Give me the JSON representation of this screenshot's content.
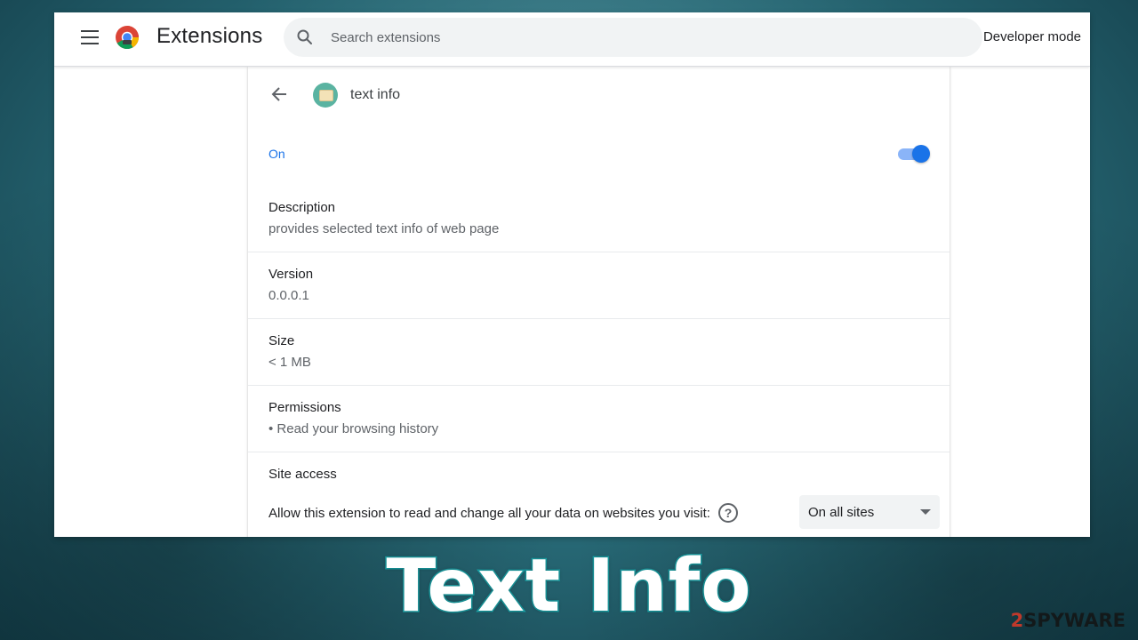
{
  "header": {
    "title": "Extensions",
    "search_placeholder": "Search extensions",
    "developer_mode_label": "Developer mode"
  },
  "extension": {
    "name": "text info",
    "status_label": "On",
    "enabled": true,
    "details": [
      {
        "label": "Description",
        "value": "provides selected text info of web page"
      },
      {
        "label": "Version",
        "value": "0.0.0.1"
      },
      {
        "label": "Size",
        "value": "< 1 MB"
      },
      {
        "label": "Permissions",
        "value": "• Read your browsing history"
      }
    ],
    "site_access": {
      "label": "Site access",
      "description": "Allow this extension to read and change all your data on websites you visit:",
      "selected_option": "On all sites"
    }
  },
  "caption": "Text Info",
  "watermark": {
    "digit": "2",
    "text": "SPYWAR",
    "tail": "E"
  },
  "colors": {
    "accent": "#1a73e8",
    "caption_outline": "#19a3a8",
    "background": "#2a6f7c"
  },
  "icons": [
    "menu-icon",
    "chrome-logo-icon",
    "search-icon",
    "back-arrow-icon",
    "extension-icon",
    "help-icon",
    "chevron-down-icon"
  ]
}
